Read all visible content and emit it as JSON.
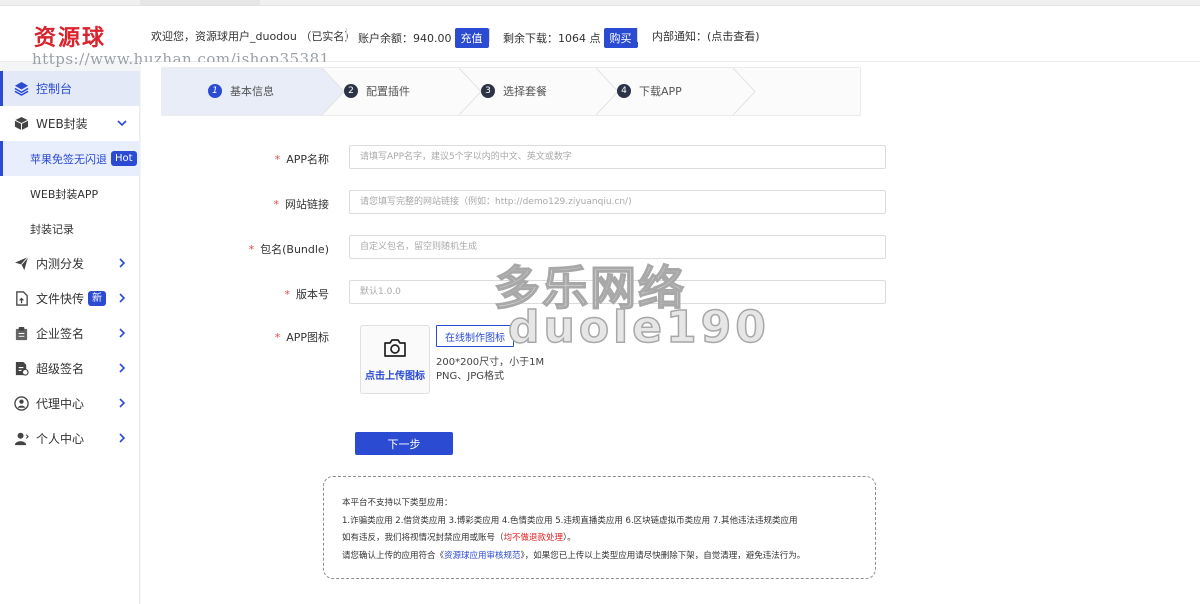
{
  "header": {
    "logo": "资源球",
    "welcome": "欢迎您，资源球用户_duodou （已实名）",
    "balance_label": "账户余额：",
    "balance_value": "940.00",
    "recharge_btn": "充值",
    "downloads_label": "剩余下载：",
    "downloads_value": "1064 点",
    "buy_btn": "购买",
    "notice": "内部通知：(点击查看)"
  },
  "url_watermark": "https://www.huzhan.com/ishop35381",
  "sidebar": {
    "items": [
      {
        "label": "控制台",
        "icon": "layers-icon"
      },
      {
        "label": "WEB封装",
        "icon": "box-icon"
      },
      {
        "label": "内测分发",
        "icon": "send-icon"
      },
      {
        "label": "文件快传",
        "icon": "file-icon",
        "badge": "新"
      },
      {
        "label": "企业签名",
        "icon": "clipboard-icon"
      },
      {
        "label": "超级签名",
        "icon": "document-sign-icon"
      },
      {
        "label": "代理中心",
        "icon": "agent-icon"
      },
      {
        "label": "个人中心",
        "icon": "user-icon"
      }
    ],
    "sub_items": [
      {
        "label": "苹果免签无闪退",
        "badge": "Hot"
      },
      {
        "label": "WEB封装APP"
      },
      {
        "label": "封装记录"
      }
    ]
  },
  "steps": [
    {
      "num": "1",
      "label": "基本信息"
    },
    {
      "num": "2",
      "label": "配置插件"
    },
    {
      "num": "3",
      "label": "选择套餐"
    },
    {
      "num": "4",
      "label": "下载APP"
    }
  ],
  "form": {
    "app_name": {
      "label": "APP名称",
      "required": "*",
      "placeholder": "请填写APP名字，建议5个字以内的中文、英文或数字"
    },
    "site_url": {
      "label": "网站链接",
      "required": "*",
      "placeholder": "请您填写完整的网站链接（例如：http://demo129.ziyuanqiu.cn/)"
    },
    "bundle": {
      "label": "包名(Bundle)",
      "required": "*",
      "placeholder": "自定义包名，留空则随机生成"
    },
    "version": {
      "label": "版本号",
      "required": "*",
      "placeholder": "默认1.0.0"
    },
    "icon": {
      "label": "APP图标",
      "required": "*",
      "upload_label": "点击上传图标",
      "online_btn": "在线制作图标",
      "hint1": "200*200尺寸，小于1M",
      "hint2": "PNG、JPG格式"
    },
    "next_btn": "下一步"
  },
  "notice": {
    "line1": "本平台不支持以下类型应用：",
    "line2": "1.诈骗类应用 2.借贷类应用 3.博彩类应用 4.色情类应用 5.违规直播类应用 6.区块链虚拟币类应用 7.其他违法违规类应用",
    "line3_a": "如有违反，我们将视情况封禁应用或账号（",
    "line3_red": "均不做退款处理",
    "line3_b": "）。",
    "line4_a": "请您确认上传的应用符合《",
    "line4_link": "资源球应用审核规范",
    "line4_b": "》，如果您已上传以上类型应用请尽快删除下架，自觉清理，避免违法行为。"
  },
  "watermark": {
    "line1": "多乐网络",
    "line2": "duole190"
  },
  "colors": {
    "primary": "#2b4bd3",
    "logo": "#d9232d",
    "required": "#e14b4b"
  }
}
